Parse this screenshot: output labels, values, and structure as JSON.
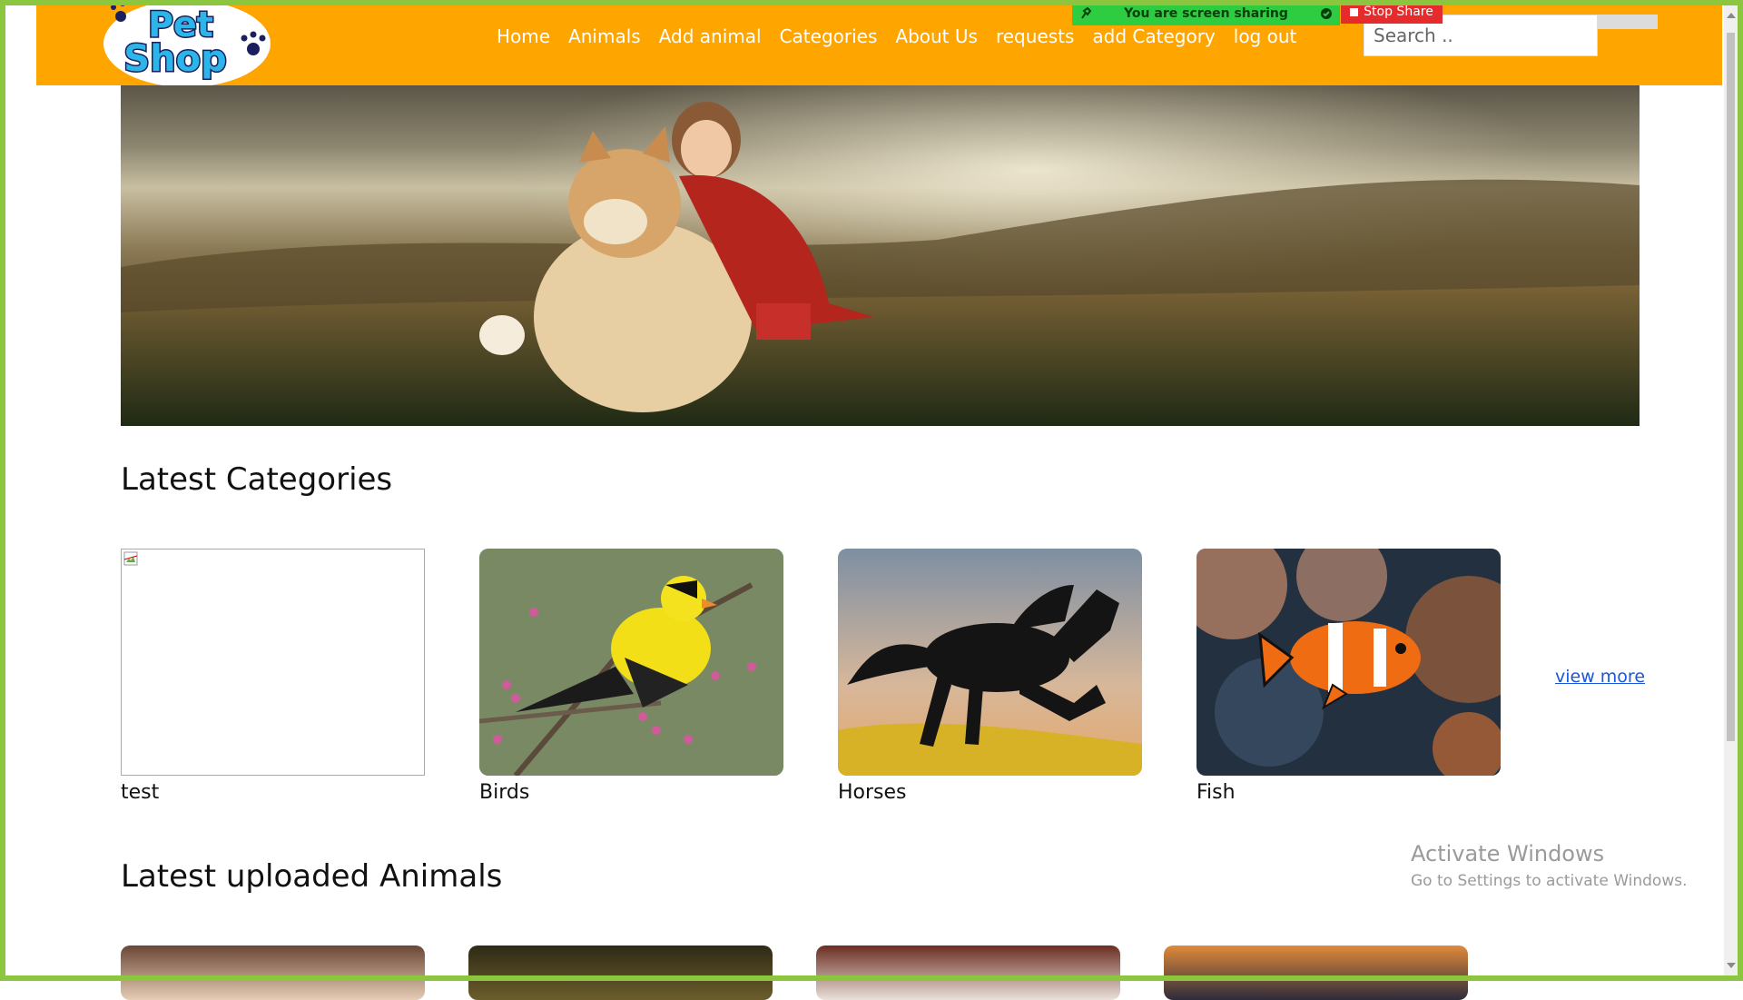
{
  "share_bar": {
    "text": "You are screen sharing",
    "stop_label": "Stop Share"
  },
  "logo": {
    "line1": "Pet",
    "line2": "Shop"
  },
  "nav": {
    "items": [
      "Home",
      "Animals",
      "Add animal",
      "Categories",
      "About Us",
      "requests",
      "add Category",
      "log out"
    ]
  },
  "search": {
    "placeholder": "Search .."
  },
  "sections": {
    "categories_title": "Latest Categories",
    "animals_title": "Latest uploaded Animals"
  },
  "categories": [
    {
      "name": "test",
      "image": "broken-image"
    },
    {
      "name": "Birds",
      "image": "goldfinch-photo"
    },
    {
      "name": "Horses",
      "image": "black-horse-photo"
    },
    {
      "name": "Fish",
      "image": "clownfish-photo"
    }
  ],
  "view_more": "view more",
  "watermark": {
    "line1": "Activate Windows",
    "line2": "Go to Settings to activate Windows."
  },
  "colors": {
    "navbar": "#ffa500",
    "frame": "#8cc63f",
    "share": "#2ecc40",
    "stop": "#e52b2b",
    "link": "#1a56db"
  }
}
